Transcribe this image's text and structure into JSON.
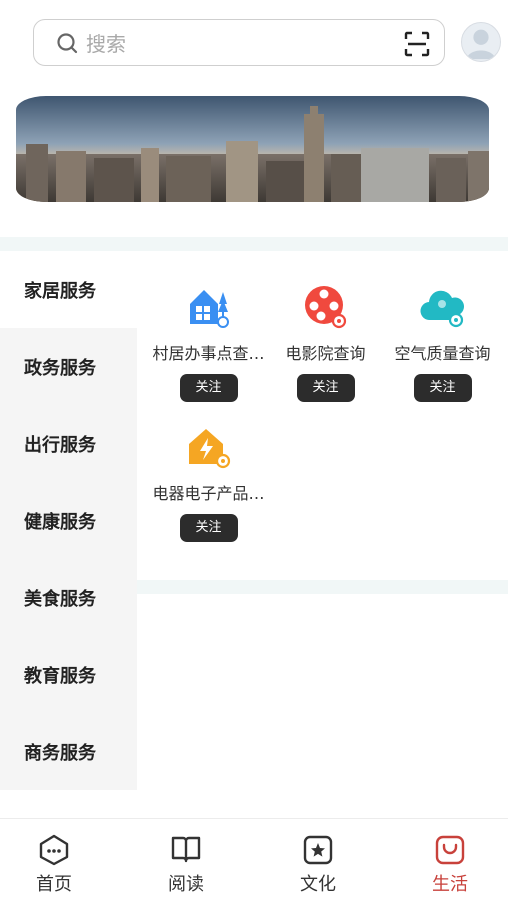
{
  "header": {
    "search_placeholder": "搜索"
  },
  "categories": [
    {
      "label": "家居服务",
      "active": true
    },
    {
      "label": "政务服务",
      "active": false
    },
    {
      "label": "出行服务",
      "active": false
    },
    {
      "label": "健康服务",
      "active": false
    },
    {
      "label": "美食服务",
      "active": false
    },
    {
      "label": "教育服务",
      "active": false
    },
    {
      "label": "商务服务",
      "active": false
    }
  ],
  "services": [
    {
      "name": "村居办事点查…",
      "follow_label": "关注",
      "icon": "house-location-icon",
      "color": "#3a8ff2"
    },
    {
      "name": "电影院查询",
      "follow_label": "关注",
      "icon": "film-reel-icon",
      "color": "#f0493e"
    },
    {
      "name": "空气质量查询",
      "follow_label": "关注",
      "icon": "cloud-search-icon",
      "color": "#22b9c4"
    },
    {
      "name": "电器电子产品…",
      "follow_label": "关注",
      "icon": "electric-house-icon",
      "color": "#f5a623"
    }
  ],
  "tabbar": [
    {
      "label": "首页",
      "icon": "home-icon",
      "active": false
    },
    {
      "label": "阅读",
      "icon": "book-icon",
      "active": false
    },
    {
      "label": "文化",
      "icon": "star-box-icon",
      "active": false
    },
    {
      "label": "生活",
      "icon": "bag-smile-icon",
      "active": true
    }
  ],
  "colors": {
    "accent": "#c8413b",
    "follow_button": "#2c2c2c",
    "divider": "#f1f7f7"
  }
}
